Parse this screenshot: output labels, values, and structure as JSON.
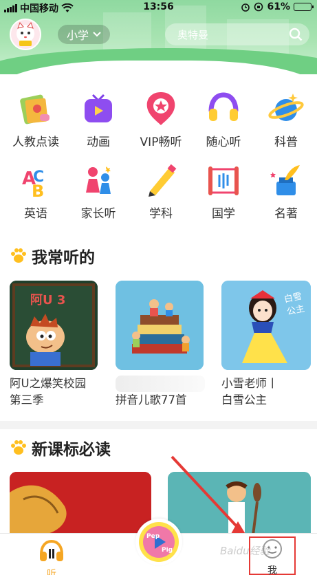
{
  "status_bar": {
    "carrier": "中国移动",
    "time": "13:56",
    "battery": "61%",
    "battery_level": 0.61
  },
  "header": {
    "grade": "小学",
    "search_placeholder": "奥特曼"
  },
  "categories": [
    {
      "label": "人教点读",
      "icon": "textbook-read-icon"
    },
    {
      "label": "动画",
      "icon": "tv-play-icon"
    },
    {
      "label": "VIP畅听",
      "icon": "vip-star-badge-icon"
    },
    {
      "label": "随心听",
      "icon": "headphones-icon"
    },
    {
      "label": "科普",
      "icon": "planet-icon"
    },
    {
      "label": "英语",
      "icon": "abc-letters-icon"
    },
    {
      "label": "家长听",
      "icon": "family-icon"
    },
    {
      "label": "学科",
      "icon": "pencil-icon"
    },
    {
      "label": "国学",
      "icon": "scroll-icon"
    },
    {
      "label": "名著",
      "icon": "ink-quill-icon"
    }
  ],
  "sections": {
    "frequent": {
      "title": "我常听的",
      "items": [
        {
          "title": "阿U之爆笑校园第三季",
          "line1": "阿U之爆笑校园",
          "line2": "第三季",
          "cover_text": "阿U 3"
        },
        {
          "title": "拼音儿歌77首",
          "line1": "",
          "line2": "拼音儿歌77首"
        },
        {
          "title": "小雪老师|白雪公主",
          "line1": "小雪老师丨",
          "line2": "白雪公主",
          "cover_text": "白雪公主"
        }
      ]
    },
    "curriculum": {
      "title": "新课标必读"
    }
  },
  "tabbar": {
    "listen": "听",
    "me": "我",
    "play_logo": "Peppa Pig"
  },
  "watermark": "Baidu经验",
  "colors": {
    "accent": "#f5a623",
    "header_green": "#8fd9a0",
    "annotation_red": "#e53935"
  }
}
